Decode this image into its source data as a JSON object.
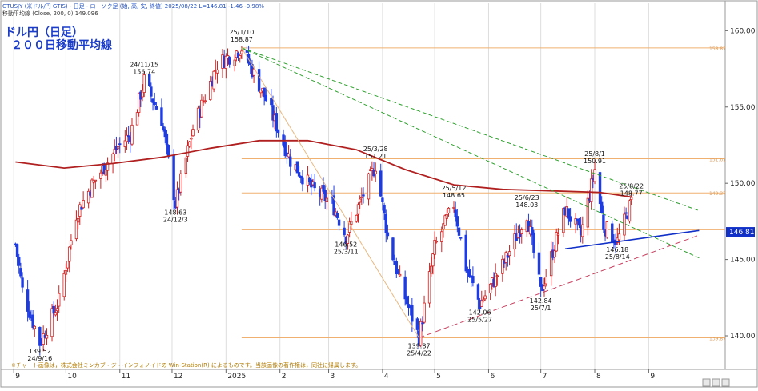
{
  "header": {
    "line1": "GTUSJY (米ドル/円 GTIS) - 日足 - ローソク足 (始, 高, 安, 終値)  2025/08/22 L=146.81 -1.46 -0.98%",
    "line2": "移動平均線 (Close, 200, 0) 149.096"
  },
  "title": {
    "line1": "ドル円（日足）",
    "line2": "２００日移動平均線"
  },
  "footnote": "※チャート画像は，株式会社ミンカブ・ジ・インフォノイドの Win-Station(R) によるものです。当該画像の著作権は，同社に帰属します。",
  "colors": {
    "up": "#d02020",
    "down": "#1e3ce0",
    "ma": "#b02020",
    "hline": "#f0b070",
    "trend_green": "#30a030",
    "trend_blue": "#1030c8",
    "trend_pink": "#c84060",
    "last_price_bg": "#1030c8"
  },
  "chart_data": {
    "type": "candlestick",
    "instrument": "USD/JPY daily",
    "ylim": [
      137.8,
      161.8
    ],
    "y_ticks": [
      "140.00",
      "145.00",
      "150.00",
      "155.00",
      "160.00"
    ],
    "x_tick_labels": [
      "9",
      "10",
      "11",
      "12",
      "2025",
      "2",
      "3",
      "4",
      "5",
      "6",
      "7",
      "8",
      "9"
    ],
    "last_price": "146.81",
    "ma_label": "200-day moving average",
    "ma_points": [
      {
        "x": "2024-09-02",
        "y": 151.4
      },
      {
        "x": "2024-09-30",
        "y": 151.0
      },
      {
        "x": "2024-10-28",
        "y": 151.3
      },
      {
        "x": "2024-11-25",
        "y": 151.7
      },
      {
        "x": "2024-12-23",
        "y": 152.3
      },
      {
        "x": "2025-01-20",
        "y": 152.8
      },
      {
        "x": "2025-02-17",
        "y": 152.8
      },
      {
        "x": "2025-03-17",
        "y": 152.2
      },
      {
        "x": "2025-04-14",
        "y": 150.9
      },
      {
        "x": "2025-05-12",
        "y": 149.9
      },
      {
        "x": "2025-06-09",
        "y": 149.6
      },
      {
        "x": "2025-07-07",
        "y": 149.5
      },
      {
        "x": "2025-08-04",
        "y": 149.4
      },
      {
        "x": "2025-08-22",
        "y": 149.1
      }
    ],
    "price_path": [
      {
        "x": "2024-09-02",
        "y": 146.0
      },
      {
        "x": "2024-09-06",
        "y": 143.0
      },
      {
        "x": "2024-09-16",
        "y": 139.52
      },
      {
        "x": "2024-09-27",
        "y": 142.3
      },
      {
        "x": "2024-10-07",
        "y": 148.0
      },
      {
        "x": "2024-10-16",
        "y": 149.9
      },
      {
        "x": "2024-10-31",
        "y": 152.4
      },
      {
        "x": "2024-11-07",
        "y": 153.2
      },
      {
        "x": "2024-11-15",
        "y": 156.74
      },
      {
        "x": "2024-11-25",
        "y": 154.2
      },
      {
        "x": "2024-12-03",
        "y": 148.63
      },
      {
        "x": "2024-12-13",
        "y": 153.6
      },
      {
        "x": "2024-12-27",
        "y": 157.8
      },
      {
        "x": "2025-01-10",
        "y": 158.87
      },
      {
        "x": "2025-01-24",
        "y": 155.5
      },
      {
        "x": "2025-02-07",
        "y": 151.5
      },
      {
        "x": "2025-02-20",
        "y": 149.6
      },
      {
        "x": "2025-03-03",
        "y": 148.7
      },
      {
        "x": "2025-03-11",
        "y": 146.52
      },
      {
        "x": "2025-03-28",
        "y": 151.21
      },
      {
        "x": "2025-04-04",
        "y": 146.5
      },
      {
        "x": "2025-04-11",
        "y": 143.5
      },
      {
        "x": "2025-04-22",
        "y": 139.87
      },
      {
        "x": "2025-05-01",
        "y": 145.8
      },
      {
        "x": "2025-05-12",
        "y": 148.65
      },
      {
        "x": "2025-05-19",
        "y": 144.5
      },
      {
        "x": "2025-05-27",
        "y": 142.06
      },
      {
        "x": "2025-06-10",
        "y": 144.8
      },
      {
        "x": "2025-06-23",
        "y": 148.03
      },
      {
        "x": "2025-07-01",
        "y": 142.84
      },
      {
        "x": "2025-07-15",
        "y": 148.3
      },
      {
        "x": "2025-07-24",
        "y": 146.6
      },
      {
        "x": "2025-08-01",
        "y": 150.91
      },
      {
        "x": "2025-08-06",
        "y": 147.2
      },
      {
        "x": "2025-08-14",
        "y": 146.18
      },
      {
        "x": "2025-08-22",
        "y": 148.77
      }
    ],
    "horizontal_lines": [
      {
        "y": 158.87,
        "label": "158.87"
      },
      {
        "y": 151.61,
        "label": "151.61"
      },
      {
        "y": 149.37,
        "label": "149.37"
      },
      {
        "y": 146.95
      },
      {
        "y": 139.87,
        "label": "139.87"
      }
    ],
    "trendlines": [
      {
        "name": "green-upper",
        "from": {
          "x": "2025-01-10",
          "y": 158.87
        },
        "to": {
          "x": "2025-09-30",
          "y": 148.2
        }
      },
      {
        "name": "green-lower",
        "from": {
          "x": "2025-01-10",
          "y": 158.87
        },
        "to": {
          "x": "2025-09-30",
          "y": 145.1
        }
      },
      {
        "name": "pink-support",
        "from": {
          "x": "2025-04-22",
          "y": 139.87
        },
        "to": {
          "x": "2025-09-30",
          "y": 146.6
        }
      },
      {
        "name": "blue-support",
        "from": {
          "x": "2025-07-15",
          "y": 145.7
        },
        "to": {
          "x": "2025-09-30",
          "y": 146.9
        }
      },
      {
        "name": "tan-fan",
        "from": {
          "x": "2025-01-10",
          "y": 158.87
        },
        "to": {
          "x": "2025-04-22",
          "y": 139.87
        }
      }
    ],
    "annotations": [
      {
        "x": "2024-09-16",
        "y": 139.52,
        "date": "24/9/16",
        "value": "139.52",
        "pos": "below"
      },
      {
        "x": "2024-11-15",
        "y": 156.74,
        "date": "24/11/15",
        "value": "156.74",
        "pos": "above"
      },
      {
        "x": "2024-12-03",
        "y": 148.63,
        "date": "24/12/3",
        "value": "148.63",
        "pos": "below"
      },
      {
        "x": "2025-01-10",
        "y": 158.87,
        "date": "25/1/10",
        "value": "158.87",
        "pos": "above"
      },
      {
        "x": "2025-03-11",
        "y": 146.52,
        "date": "25/3/11",
        "value": "146.52",
        "pos": "below"
      },
      {
        "x": "2025-03-28",
        "y": 151.21,
        "date": "25/3/28",
        "value": "151.21",
        "pos": "above"
      },
      {
        "x": "2025-04-22",
        "y": 139.87,
        "date": "25/4/22",
        "value": "139.87",
        "pos": "below"
      },
      {
        "x": "2025-05-12",
        "y": 148.65,
        "date": "25/5/12",
        "value": "148.65",
        "pos": "above"
      },
      {
        "x": "2025-05-27",
        "y": 142.06,
        "date": "25/5/27",
        "value": "142.06",
        "pos": "below"
      },
      {
        "x": "2025-06-23",
        "y": 148.03,
        "date": "25/6/23",
        "value": "148.03",
        "pos": "above"
      },
      {
        "x": "2025-07-01",
        "y": 142.84,
        "date": "25/7/1",
        "value": "142.84",
        "pos": "below"
      },
      {
        "x": "2025-08-01",
        "y": 150.91,
        "date": "25/8/1",
        "value": "150.91",
        "pos": "above"
      },
      {
        "x": "2025-08-14",
        "y": 146.18,
        "date": "25/8/14",
        "value": "146.18",
        "pos": "below"
      },
      {
        "x": "2025-08-22",
        "y": 148.77,
        "date": "25/8/22",
        "value": "148.77",
        "pos": "above"
      }
    ]
  }
}
